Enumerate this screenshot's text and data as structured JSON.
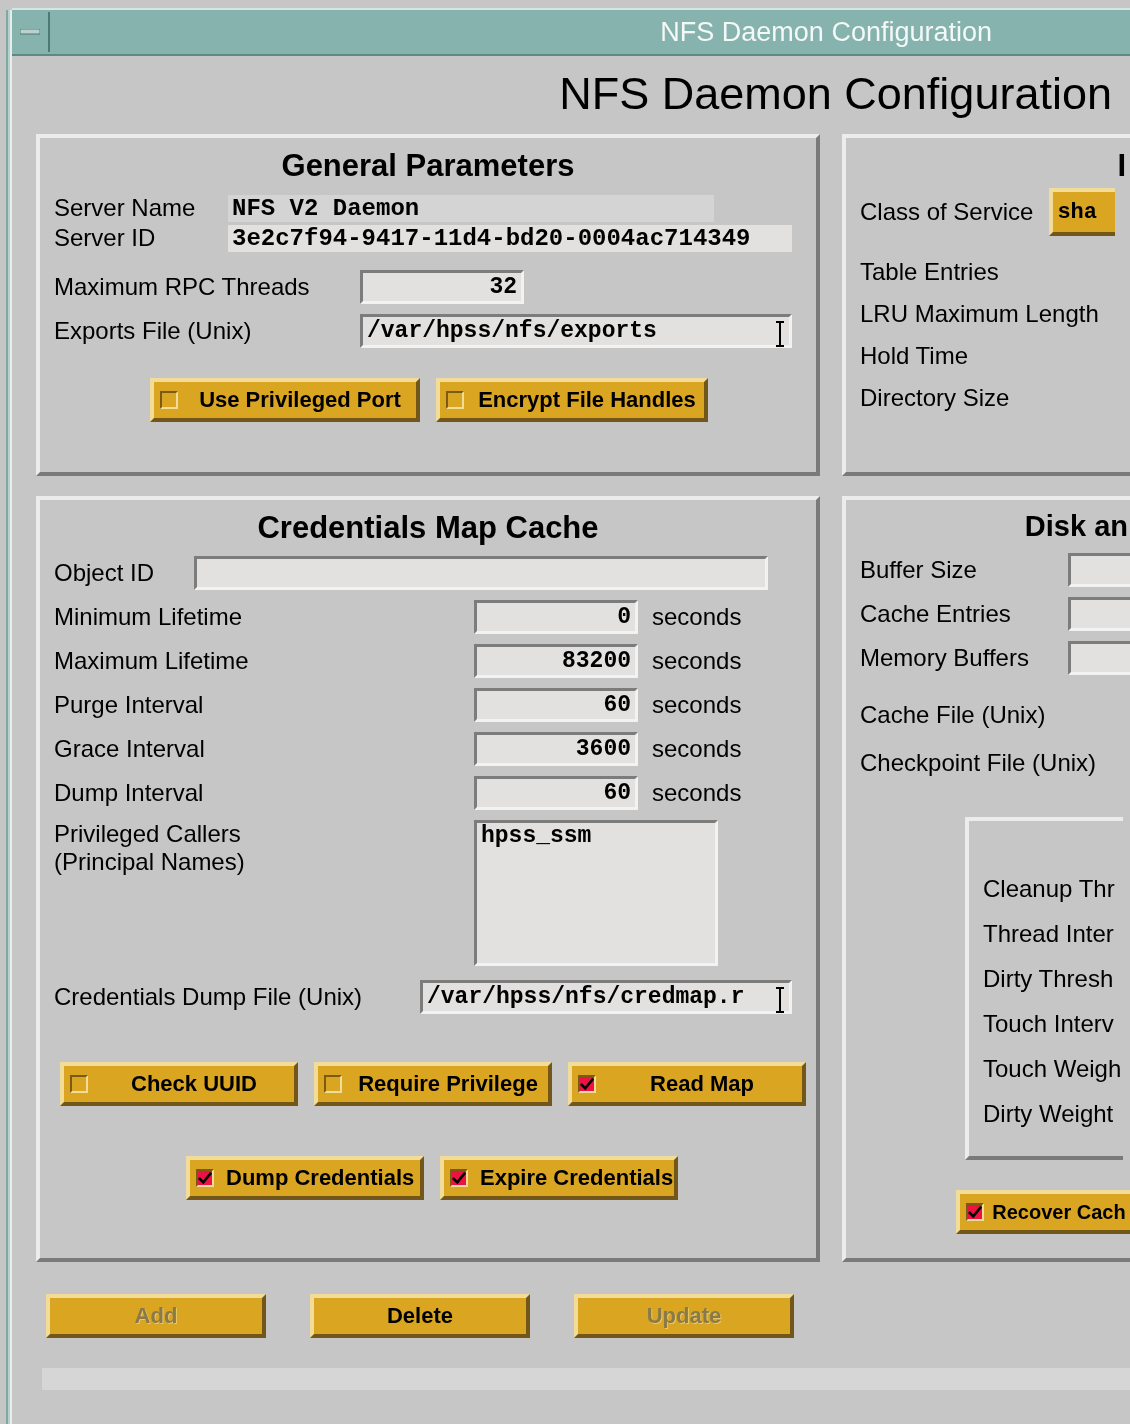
{
  "window": {
    "title": "NFS Daemon Configuration"
  },
  "heading": "NFS Daemon Configuration",
  "general": {
    "title": "General Parameters",
    "info": [
      {
        "label": "Server Name",
        "value": "NFS V2 Daemon"
      },
      {
        "label": "Server ID",
        "value": "3e2c7f94-9417-11d4-bd20-0004ac714349"
      }
    ],
    "fields": [
      {
        "label": "Maximum RPC Threads",
        "value": "32",
        "kind": "number",
        "cursor": false
      },
      {
        "label": "Exports File (Unix)",
        "value": "/var/hpss/nfs/exports",
        "kind": "path",
        "cursor": true
      }
    ],
    "toggles": [
      {
        "label": "Use Privileged Port",
        "checked": false
      },
      {
        "label": "Encrypt File Handles",
        "checked": false
      }
    ]
  },
  "credentials": {
    "title": "Credentials Map Cache",
    "object_id": {
      "label": "Object ID"
    },
    "intervals": [
      {
        "label": "Minimum Lifetime",
        "value": "0",
        "unit": "seconds"
      },
      {
        "label": "Maximum Lifetime",
        "value": "83200",
        "unit": "seconds"
      },
      {
        "label": "Purge Interval",
        "value": "60",
        "unit": "seconds"
      },
      {
        "label": "Grace Interval",
        "value": "3600",
        "unit": "seconds"
      },
      {
        "label": "Dump Interval",
        "value": "60",
        "unit": "seconds"
      }
    ],
    "callers": {
      "label_lines": [
        "Privileged Callers",
        "(Principal Names)"
      ],
      "value": "hpss_ssm"
    },
    "dump_file": {
      "label": "Credentials Dump File (Unix)",
      "value": "/var/hpss/nfs/credmap.r",
      "cursor": true
    },
    "toggle_rows": [
      [
        {
          "label": "Check UUID",
          "checked": false
        },
        {
          "label": "Require Privilege",
          "checked": false
        },
        {
          "label": "Read Map",
          "checked": true
        }
      ],
      [
        {
          "label": "Dump Credentials",
          "checked": true
        },
        {
          "label": "Expire Credentials",
          "checked": true
        }
      ]
    ]
  },
  "right_top": {
    "title": "I",
    "class_of_service": {
      "label": "Class of Service",
      "value": "sha"
    },
    "labels": [
      "Table Entries",
      "LRU Maximum Length",
      "Hold Time",
      "Directory Size"
    ]
  },
  "disk": {
    "title": "Disk an",
    "fields": [
      "Buffer Size",
      "Cache Entries",
      "Memory Buffers"
    ],
    "file_labels": [
      "Cache File (Unix)",
      "Checkpoint File (Unix)"
    ],
    "sub_labels": [
      "Cleanup Thr",
      "Thread Inter",
      "Dirty Thresh",
      "Touch Interv",
      "Touch Weigh",
      "Dirty Weight"
    ],
    "toggle": {
      "label": "Recover Cach",
      "checked": true
    }
  },
  "buttons": [
    {
      "label": "Add",
      "disabled": true
    },
    {
      "label": "Delete",
      "disabled": false
    },
    {
      "label": "Update",
      "disabled": true
    }
  ]
}
